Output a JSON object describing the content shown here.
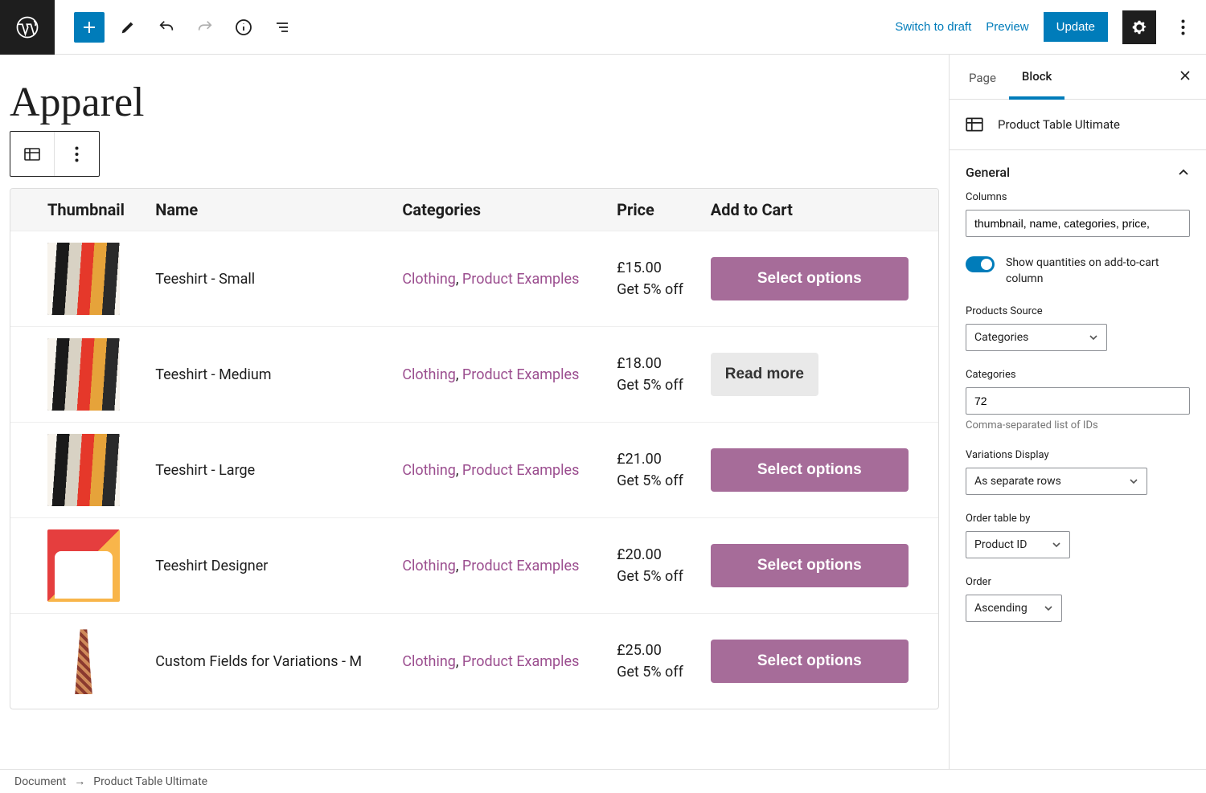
{
  "topbar": {
    "switch_label": "Switch to draft",
    "preview_label": "Preview",
    "update_label": "Update"
  },
  "editor": {
    "page_title": "Apparel"
  },
  "table": {
    "headers": {
      "thumb": "Thumbnail",
      "name": "Name",
      "cats": "Categories",
      "price": "Price",
      "cart": "Add to Cart"
    },
    "cat1": "Clothing",
    "cat2": "Product Examples",
    "discount": "Get 5% off",
    "rows": [
      {
        "name": "Teeshirt - Small",
        "price": "£15.00",
        "action": "Select options",
        "style": "hang"
      },
      {
        "name": "Teeshirt - Medium",
        "price": "£18.00",
        "action": "Read more",
        "style": "hang"
      },
      {
        "name": "Teeshirt - Large",
        "price": "£21.00",
        "action": "Select options",
        "style": "hang"
      },
      {
        "name": "Teeshirt Designer",
        "price": "£20.00",
        "action": "Select options",
        "style": "designer"
      },
      {
        "name": "Custom Fields for Variations - M",
        "price": "£25.00",
        "action": "Select options",
        "style": "dress"
      }
    ]
  },
  "sidebar": {
    "tab_page": "Page",
    "tab_block": "Block",
    "block_name": "Product Table Ultimate",
    "section_general": "General",
    "columns_label": "Columns",
    "columns_value": "thumbnail, name, categories, price,",
    "show_qty_label": "Show quantities on add-to-cart column",
    "source_label": "Products Source",
    "source_value": "Categories",
    "categories_label": "Categories",
    "categories_value": "72",
    "categories_help": "Comma-separated list of IDs",
    "variations_label": "Variations Display",
    "variations_value": "As separate rows",
    "orderby_label": "Order table by",
    "orderby_value": "Product ID",
    "order_label": "Order",
    "order_value": "Ascending"
  },
  "footer": {
    "crumb1": "Document",
    "crumb2": "Product Table Ultimate"
  }
}
